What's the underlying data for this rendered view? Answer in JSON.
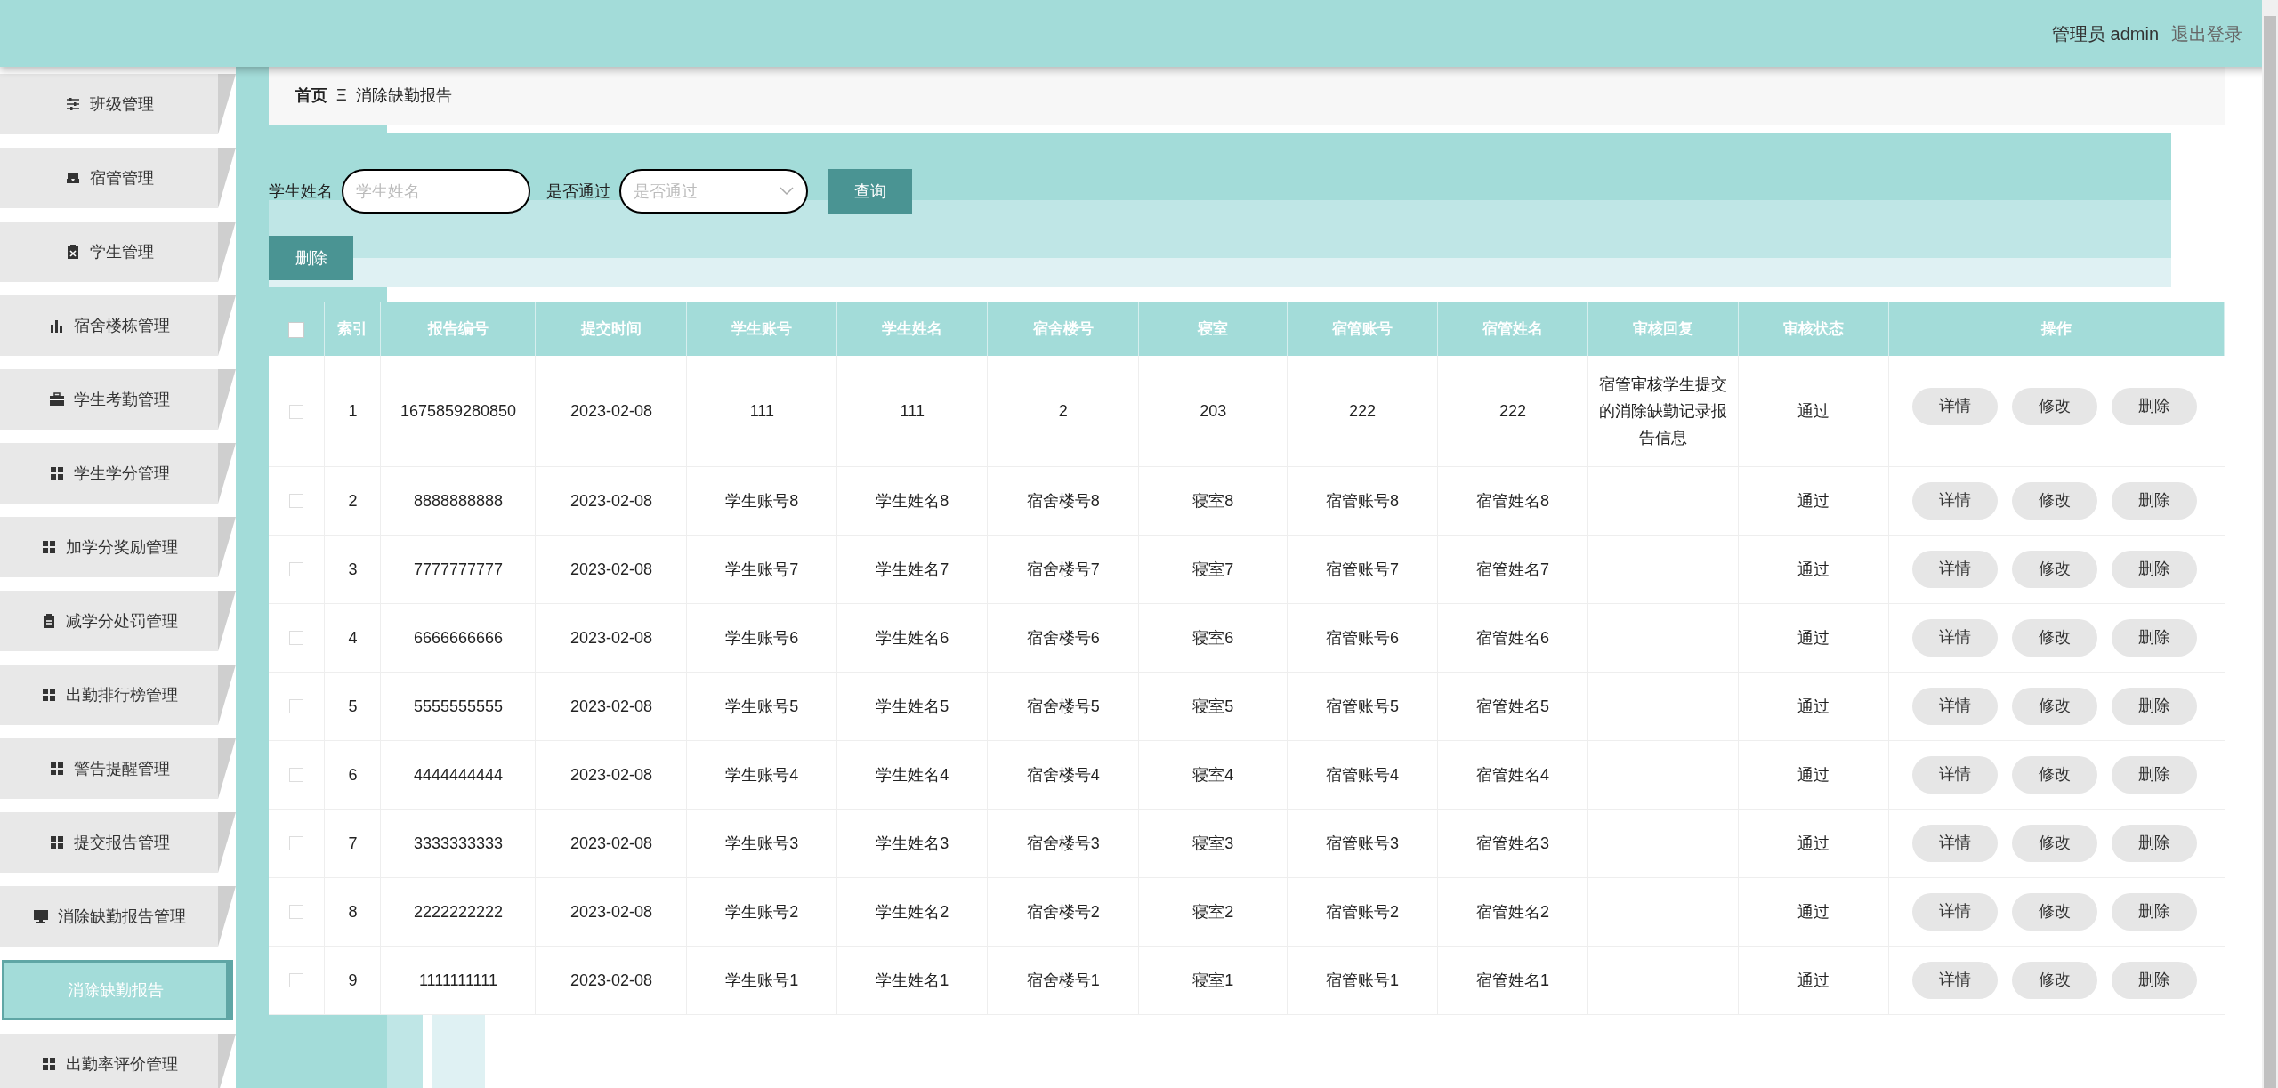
{
  "header": {
    "user_label": "管理员 admin",
    "logout": "退出登录"
  },
  "sidebar": {
    "items": [
      {
        "label": "班级管理",
        "selected": false
      },
      {
        "label": "宿管管理",
        "selected": false
      },
      {
        "label": "学生管理",
        "selected": false
      },
      {
        "label": "宿舍楼栋管理",
        "selected": false
      },
      {
        "label": "学生考勤管理",
        "selected": false
      },
      {
        "label": "学生学分管理",
        "selected": false
      },
      {
        "label": "加学分奖励管理",
        "selected": false
      },
      {
        "label": "减学分处罚管理",
        "selected": false
      },
      {
        "label": "出勤排行榜管理",
        "selected": false
      },
      {
        "label": "警告提醒管理",
        "selected": false
      },
      {
        "label": "提交报告管理",
        "selected": false
      },
      {
        "label": "消除缺勤报告管理",
        "selected": false
      },
      {
        "label": "消除缺勤报告",
        "selected": true
      },
      {
        "label": "出勤率评价管理",
        "selected": false
      }
    ]
  },
  "breadcrumb": {
    "home": "首页",
    "separator": "Ξ",
    "current": "消除缺勤报告"
  },
  "search": {
    "name_label": "学生姓名",
    "name_placeholder": "学生姓名",
    "pass_label": "是否通过",
    "pass_placeholder": "是否通过",
    "query_button": "查询"
  },
  "delete_button": "删除",
  "table": {
    "columns": [
      "索引",
      "报告编号",
      "提交时间",
      "学生账号",
      "学生姓名",
      "宿舍楼号",
      "寝室",
      "宿管账号",
      "宿管姓名",
      "审核回复",
      "审核状态",
      "操作"
    ],
    "header_checked": false,
    "rows": [
      {
        "checked": false,
        "actions": [
          "详情",
          "修改",
          "删除"
        ],
        "cells": [
          "1",
          "1675859280850",
          "2023-02-08",
          "111",
          "111",
          "2",
          "203",
          "222",
          "222",
          "宿管审核学生提交的消除缺勤记录报告信息",
          "通过"
        ]
      },
      {
        "checked": false,
        "actions": [
          "详情",
          "修改",
          "删除"
        ],
        "cells": [
          "2",
          "8888888888",
          "2023-02-08",
          "学生账号8",
          "学生姓名8",
          "宿舍楼号8",
          "寝室8",
          "宿管账号8",
          "宿管姓名8",
          "",
          "通过"
        ]
      },
      {
        "checked": false,
        "actions": [
          "详情",
          "修改",
          "删除"
        ],
        "cells": [
          "3",
          "7777777777",
          "2023-02-08",
          "学生账号7",
          "学生姓名7",
          "宿舍楼号7",
          "寝室7",
          "宿管账号7",
          "宿管姓名7",
          "",
          "通过"
        ]
      },
      {
        "checked": false,
        "actions": [
          "详情",
          "修改",
          "删除"
        ],
        "cells": [
          "4",
          "6666666666",
          "2023-02-08",
          "学生账号6",
          "学生姓名6",
          "宿舍楼号6",
          "寝室6",
          "宿管账号6",
          "宿管姓名6",
          "",
          "通过"
        ]
      },
      {
        "checked": false,
        "actions": [
          "详情",
          "修改",
          "删除"
        ],
        "cells": [
          "5",
          "5555555555",
          "2023-02-08",
          "学生账号5",
          "学生姓名5",
          "宿舍楼号5",
          "寝室5",
          "宿管账号5",
          "宿管姓名5",
          "",
          "通过"
        ]
      },
      {
        "checked": false,
        "actions": [
          "详情",
          "修改",
          "删除"
        ],
        "cells": [
          "6",
          "4444444444",
          "2023-02-08",
          "学生账号4",
          "学生姓名4",
          "宿舍楼号4",
          "寝室4",
          "宿管账号4",
          "宿管姓名4",
          "",
          "通过"
        ]
      },
      {
        "checked": false,
        "actions": [
          "详情",
          "修改",
          "删除"
        ],
        "cells": [
          "7",
          "3333333333",
          "2023-02-08",
          "学生账号3",
          "学生姓名3",
          "宿舍楼号3",
          "寝室3",
          "宿管账号3",
          "宿管姓名3",
          "",
          "通过"
        ]
      },
      {
        "checked": false,
        "actions": [
          "详情",
          "修改",
          "删除"
        ],
        "cells": [
          "8",
          "2222222222",
          "2023-02-08",
          "学生账号2",
          "学生姓名2",
          "宿舍楼号2",
          "寝室2",
          "宿管账号2",
          "宿管姓名2",
          "",
          "通过"
        ]
      },
      {
        "checked": false,
        "actions": [
          "详情",
          "修改",
          "删除"
        ],
        "cells": [
          "9",
          "1111111111",
          "2023-02-08",
          "学生账号1",
          "学生姓名1",
          "宿舍楼号1",
          "寝室1",
          "宿管账号1",
          "宿管姓名1",
          "",
          "通过"
        ]
      }
    ]
  }
}
